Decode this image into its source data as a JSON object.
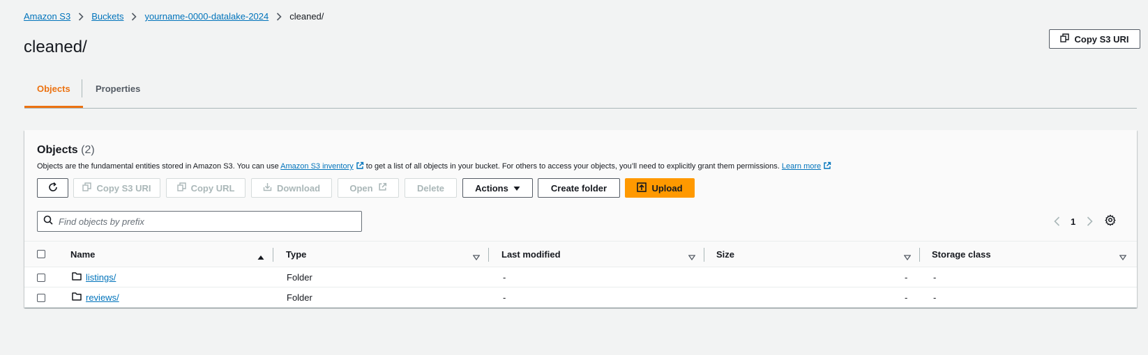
{
  "breadcrumb": {
    "items": [
      "Amazon S3",
      "Buckets",
      "yourname-0000-datalake-2024"
    ],
    "current": "cleaned/"
  },
  "page": {
    "title": "cleaned/",
    "copy_uri_label": "Copy S3 URI"
  },
  "tabs": [
    {
      "label": "Objects",
      "active": true
    },
    {
      "label": "Properties",
      "active": false
    }
  ],
  "objects_panel": {
    "title": "Objects",
    "count": "(2)",
    "desc_before": "Objects are the fundamental entities stored in Amazon S3. You can use ",
    "desc_link": "Amazon S3 inventory",
    "desc_middle": " to get a list of all objects in your bucket. For others to access your objects, you’ll need to explicitly grant them permissions. ",
    "desc_learn_more": "Learn more",
    "toolbar": {
      "copy_s3_uri": "Copy S3 URI",
      "copy_url": "Copy URL",
      "download": "Download",
      "open": "Open",
      "delete": "Delete",
      "actions": "Actions",
      "create_folder": "Create folder",
      "upload": "Upload"
    },
    "search_placeholder": "Find objects by prefix",
    "page_number": "1",
    "columns": [
      "Name",
      "Type",
      "Last modified",
      "Size",
      "Storage class"
    ],
    "rows": [
      {
        "name": "listings/",
        "type": "Folder",
        "last_modified": "-",
        "size": "-",
        "storage_class": "-"
      },
      {
        "name": "reviews/",
        "type": "Folder",
        "last_modified": "-",
        "size": "-",
        "storage_class": "-"
      }
    ]
  },
  "colors": {
    "accent": "#ec7211",
    "link": "#0073bb",
    "primary_button": "#ff9900"
  },
  "icons": [
    "chevron-right-icon",
    "copy-icon",
    "refresh-icon",
    "download-icon",
    "external-link-icon",
    "caret-down-icon",
    "upload-icon",
    "search-icon",
    "chevron-left-icon",
    "settings-icon",
    "sort-ascending-icon",
    "sort-icon",
    "folder-icon"
  ]
}
